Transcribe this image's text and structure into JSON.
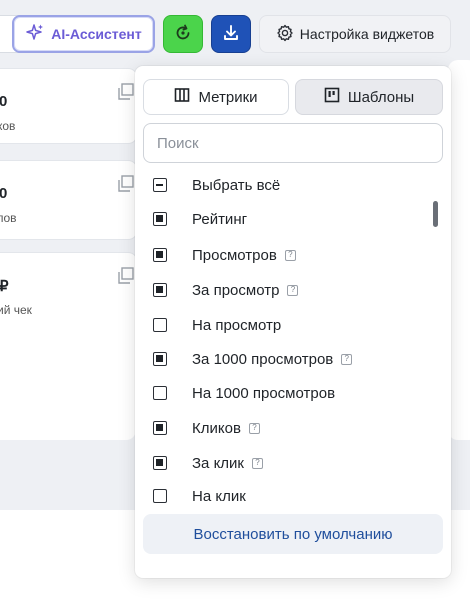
{
  "toolbar": {
    "ai_label": "AI-Ассистент",
    "settings_label": "Настройка виджетов"
  },
  "background_cards": [
    {
      "value": "0",
      "label": "ков"
    },
    {
      "value": "0",
      "label": "пов"
    },
    {
      "value": "₽",
      "label": "ий чек"
    }
  ],
  "panel": {
    "tabs": [
      {
        "label": "Метрики",
        "icon": "columns-icon"
      },
      {
        "label": "Шаблоны",
        "icon": "template-icon"
      }
    ],
    "search_placeholder": "Поиск",
    "items": [
      {
        "label": "Выбрать всё",
        "state": "indeterminate",
        "help": false
      },
      {
        "label": "Рейтинг",
        "state": "checked",
        "help": false
      },
      {
        "label": "Просмотров",
        "state": "checked",
        "help": true
      },
      {
        "label": "За просмотр",
        "state": "checked",
        "help": true
      },
      {
        "label": "На просмотр",
        "state": "unchecked",
        "help": false
      },
      {
        "label": "За 1000 просмотров",
        "state": "checked",
        "help": true
      },
      {
        "label": "На 1000 просмотров",
        "state": "unchecked",
        "help": false
      },
      {
        "label": "Кликов",
        "state": "checked",
        "help": true
      },
      {
        "label": "За клик",
        "state": "checked",
        "help": true
      },
      {
        "label": "На клик",
        "state": "unchecked",
        "help": false
      }
    ],
    "help_glyph": "?",
    "restore_label": "Восстановить по умолчанию"
  },
  "colors": {
    "ai_accent": "#6b5cd6",
    "refresh_bg": "#4bd44b",
    "download_bg": "#1f52b7",
    "restore_text": "#1f4e9c"
  }
}
